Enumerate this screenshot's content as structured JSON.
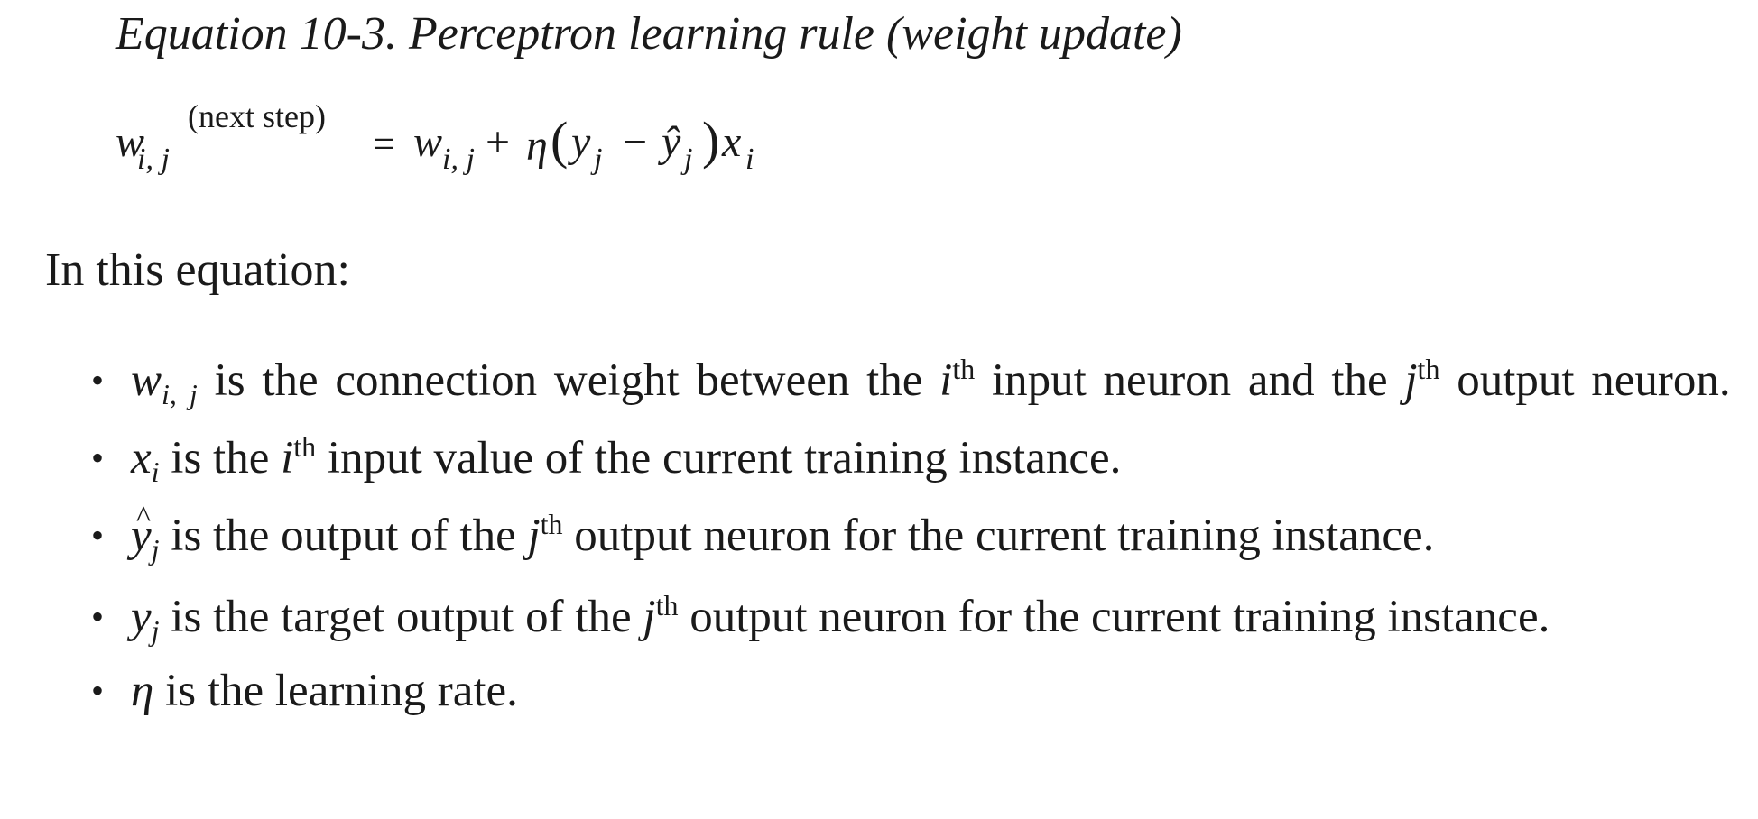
{
  "caption": "Equation 10-3. Perceptron learning rule (weight update)",
  "equation": {
    "lhs_symbol": "w",
    "lhs_subscript": "i, j",
    "lhs_superscript": "(next step)",
    "equals": "=",
    "rhs_w": "w",
    "rhs_w_sub": "i, j",
    "plus": "+",
    "eta": "η",
    "open_paren": "(",
    "y": "y",
    "y_sub": "j",
    "minus": "−",
    "yhat": "ŷ",
    "yhat_sub": "j",
    "close_paren": ")",
    "x": "x",
    "x_sub": "i"
  },
  "intro": "In this equation:",
  "bullets": [
    {
      "symbol": "w",
      "symbol_sub": "i, j",
      "t1": " is the connection weight between the ",
      "ord1": "i",
      "ord1_sup": "th",
      "t2": " input neuron and the ",
      "ord2": "j",
      "ord2_sup": "th",
      "t3": " output neuron."
    },
    {
      "symbol": "x",
      "symbol_sub": "i",
      "t1": " is the ",
      "ord1": "i",
      "ord1_sup": "th",
      "t2": " input value of the current training instance."
    },
    {
      "symbol": "y",
      "symbol_sub": "j",
      "t1": " is the output of the ",
      "ord1": "j",
      "ord1_sup": "th",
      "t2": " output neuron for the current training instance."
    },
    {
      "symbol": "y",
      "symbol_sub": "j",
      "t1": " is the target output of the ",
      "ord1": "j",
      "ord1_sup": "th",
      "t2": " output neuron for the current training instance."
    },
    {
      "symbol": "η",
      "t1": " is the learning rate."
    }
  ],
  "bullet_glyph": "•"
}
